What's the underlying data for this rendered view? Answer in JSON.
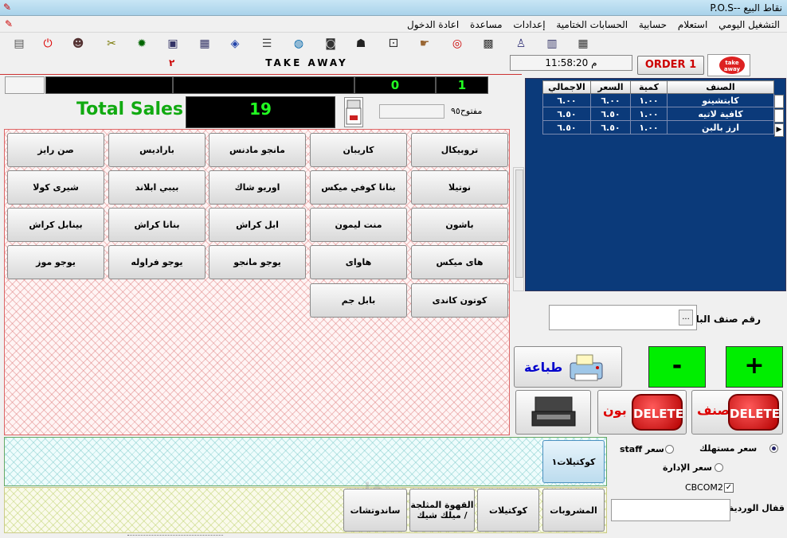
{
  "window": {
    "title": "نقاط البيع --P.O.S"
  },
  "menu": [
    "التشغيل اليومي",
    "استعلام",
    "حسابية",
    "الحسابات الختامية",
    "إعدادات",
    "مساعدة",
    "اعادة الدخول"
  ],
  "toolbar_icons": [
    "save-icon",
    "power-icon",
    "people-icon",
    "tools-icon",
    "gear-icon",
    "monitor-icon",
    "notepad-icon",
    "chart-icon",
    "cycle-icon",
    "list-icon",
    "globe-icon",
    "camera-icon",
    "mask-icon",
    "dice-icon",
    "hand-icon",
    "lifebuoy-icon",
    "contacts-icon",
    "bottle-icon",
    "calendar-icon",
    "calculator-icon"
  ],
  "header": {
    "take_away": "TAKE AWAY",
    "red_count": "٢",
    "clock": "م 11:58:20",
    "order_button": "ORDER 1"
  },
  "display": {
    "box1": "",
    "box2": "",
    "box3": "0",
    "box4": "1",
    "total_label": "Total Sales :",
    "total_value": "19",
    "open_label": "مفتوح٩٥"
  },
  "products": [
    "تروبيكال",
    "كاريبان",
    "مانجو مادنس",
    "باراديس",
    "صن رايز",
    "نوتيلا",
    "بنانا كوفي ميكس",
    "اوريو شاك",
    "بيبي ابلاند",
    "شيرى كولا",
    "باشون",
    "منت ليمون",
    "ابل كراش",
    "بنانا كراش",
    "بينابل كراش",
    "هاى ميكس",
    "هاواى",
    "يوجو مانجو",
    "يوجو فراوله",
    "يوجو موز",
    "كوتون كاندى",
    "بابل جم"
  ],
  "order_grid": {
    "columns": [
      "الصنف",
      "كمية",
      "السعر",
      "الاجمالي"
    ],
    "rows": [
      {
        "item": "كابتشينو",
        "qty": "١.٠٠",
        "price": "٦.٠٠",
        "total": "٦.٠٠"
      },
      {
        "item": "كافية لاتيه",
        "qty": "١.٠٠",
        "price": "٦.٥٠",
        "total": "٦.٥٠"
      },
      {
        "item": "ارز بالبن",
        "qty": "١.٠٠",
        "price": "٦.٥٠",
        "total": "٦.٥٠"
      }
    ]
  },
  "barcode": {
    "label": "رقم صنف الباركود :",
    "value": "",
    "button": "..."
  },
  "actions": {
    "print": "طباعة",
    "minus": "-",
    "plus": "+",
    "delete": "DELETE",
    "delete_order": "بون",
    "delete_item": "صنف"
  },
  "categories_top": [
    "كوكتيلات١"
  ],
  "categories_bottom": [
    "المشروبات",
    "كوكتيلات",
    "القهوة المثلجة / ميلك شيك",
    "ساندوتشات"
  ],
  "pricing": {
    "consumer": "سعر مستهلك",
    "staff": "سعر staff",
    "admin": "سعر الإدارة",
    "selected": "consumer"
  },
  "cbcom": {
    "label": "CBCOM2",
    "checked": true
  },
  "shift": {
    "label": "قفال الوردية :",
    "value": ""
  },
  "watermark": "مستقل",
  "colors": {
    "grid_bg": "#0b3a7a",
    "display_green": "#22ff22",
    "accent_red": "#cc0000",
    "button_green": "#00ee00"
  }
}
